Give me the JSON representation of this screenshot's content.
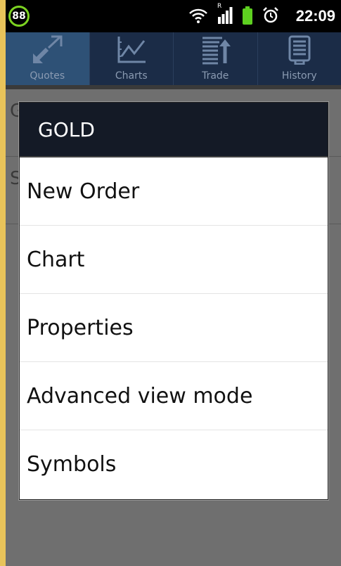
{
  "status_bar": {
    "battery_badge": "88",
    "time": "22:09",
    "icons": [
      "wifi-icon",
      "signal-icon",
      "battery-icon",
      "alarm-icon"
    ],
    "signal_roaming": "R"
  },
  "tabs": [
    {
      "label": "Quotes",
      "icon": "quotes-arrows-icon",
      "active": true
    },
    {
      "label": "Charts",
      "icon": "chart-line-icon",
      "active": false
    },
    {
      "label": "Trade",
      "icon": "trade-list-icon",
      "active": false
    },
    {
      "label": "History",
      "icon": "history-document-icon",
      "active": false
    }
  ],
  "dialog": {
    "title": "GOLD",
    "items": [
      "New Order",
      "Chart",
      "Properties",
      "Advanced view mode",
      "Symbols"
    ]
  },
  "background_rows": [
    "G",
    "S"
  ],
  "colors": {
    "frame": "#e8c35a",
    "tabbar": "#1b2c47",
    "tab_active": "#2e5176",
    "dialog_title_bg": "#141a26",
    "battery_badge_ring": "#7cd321",
    "battery_green": "#5ed020"
  }
}
